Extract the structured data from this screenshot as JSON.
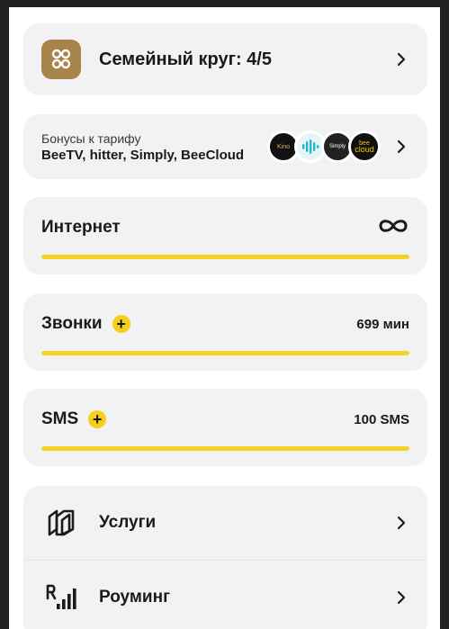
{
  "family": {
    "title": "Семейный круг: 4/5"
  },
  "bonus": {
    "label": "Бонусы к тарифу",
    "names": "BeeTV, hitter, Simply, BeeCloud",
    "icons": [
      {
        "name": "kino-icon",
        "text": "Kino"
      },
      {
        "name": "hitter-icon",
        "text": ""
      },
      {
        "name": "simply-icon",
        "text": "Simply"
      },
      {
        "name": "beecloud-icon",
        "text_top": "bee",
        "text_bottom": "cloud"
      }
    ]
  },
  "packages": {
    "internet": {
      "title": "Интернет",
      "value_icon": "infinity-icon",
      "fill": 1.0
    },
    "calls": {
      "title": "Звонки",
      "value": "699 мин",
      "fill": 1.0
    },
    "sms": {
      "title": "SMS",
      "value": "100 SMS",
      "fill": 1.0
    }
  },
  "menu": {
    "items": [
      {
        "label": "Услуги",
        "icon": "services-icon"
      },
      {
        "label": "Роуминг",
        "icon": "roaming-icon"
      }
    ]
  },
  "colors": {
    "accent": "#f5cf19",
    "family_icon_bg": "#a9844a",
    "card_bg": "#f2f2f4"
  }
}
